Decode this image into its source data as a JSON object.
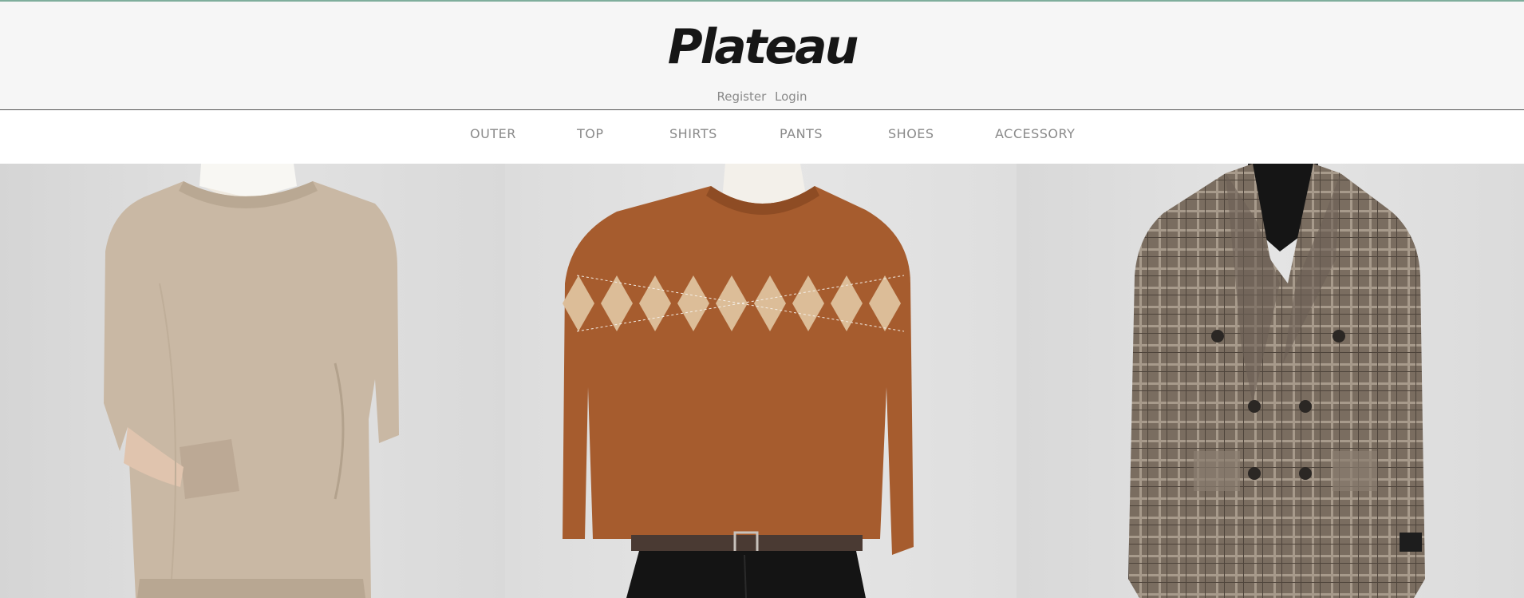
{
  "brand": {
    "name": "Plateau"
  },
  "auth": {
    "register": "Register",
    "login": "Login"
  },
  "nav": {
    "items": [
      {
        "label": "OUTER",
        "id": "outer"
      },
      {
        "label": "TOP",
        "id": "top"
      },
      {
        "label": "SHIRTS",
        "id": "shirts"
      },
      {
        "label": "PANTS",
        "id": "pants"
      },
      {
        "label": "SHOES",
        "id": "shoes"
      },
      {
        "label": "ACCESSORY",
        "id": "accessory"
      }
    ]
  },
  "products": [
    {
      "name": "beige-crewneck-sweater",
      "color": "#c9b8a4"
    },
    {
      "name": "brown-argyle-sweater",
      "color": "#a65c2e"
    },
    {
      "name": "plaid-double-breasted-blazer",
      "color": "#7a6d60"
    }
  ],
  "colors": {
    "accent": "#7fae9c",
    "header_bg": "#f6f6f6",
    "nav_text": "#8a8a8a"
  }
}
